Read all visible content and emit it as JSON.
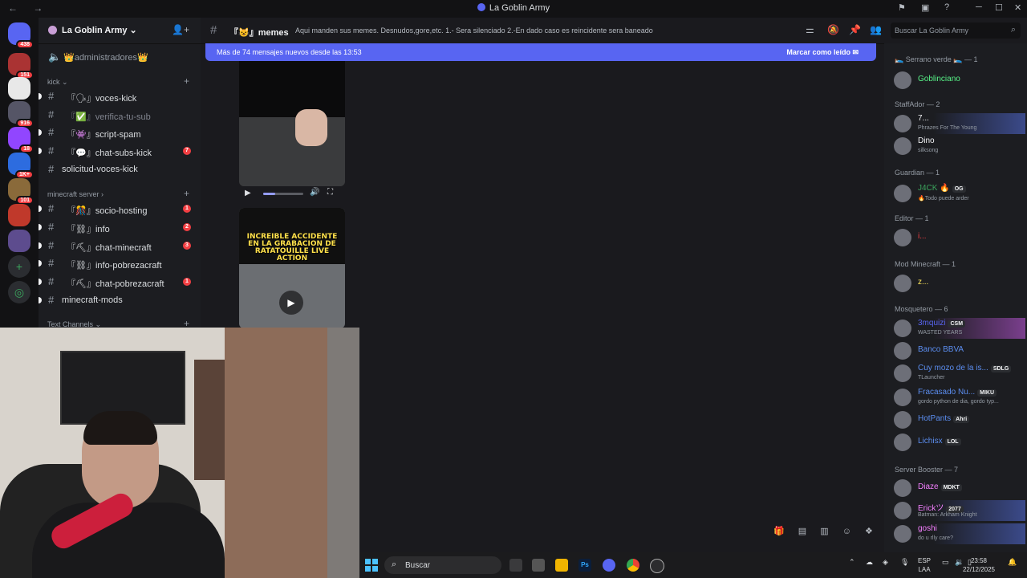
{
  "window": {
    "title": "La Goblin Army"
  },
  "servers": [
    {
      "badge": "438"
    },
    {
      "badge": "151"
    },
    {
      "badge": ""
    },
    {
      "badge": "916"
    },
    {
      "badge": "18"
    },
    {
      "badge": "1K+"
    },
    {
      "badge": "101"
    },
    {
      "badge": ""
    },
    {
      "badge": ""
    }
  ],
  "guild": {
    "name": "La Goblin Army"
  },
  "channels": {
    "top_item": "👑administradores👑",
    "categories": [
      {
        "name": "kick"
      },
      {
        "name": "minecraft server"
      },
      {
        "name": "Text Channels"
      }
    ],
    "items": [
      {
        "label": "『🗣』voces-kick",
        "count": ""
      },
      {
        "label": "『✅』verifica-tu-sub",
        "count": ""
      },
      {
        "label": "『👾』script-spam",
        "count": ""
      },
      {
        "label": "『💬』chat-subs-kick",
        "count": "7"
      },
      {
        "label": "solicitud-voces-kick",
        "count": ""
      },
      {
        "label": "『🎊』socio-hosting",
        "count": "1"
      },
      {
        "label": "『⛓』info",
        "count": "2"
      },
      {
        "label": "『⛏』chat-minecraft",
        "count": "3"
      },
      {
        "label": "『⛓』info-pobrezacraft",
        "count": ""
      },
      {
        "label": "『⛏』chat-pobrezacraft",
        "count": "1"
      },
      {
        "label": "minecraft-mods",
        "count": ""
      }
    ]
  },
  "channel_header": {
    "name": "『😺』memes",
    "topic": "Aqui manden sus memes. Desnudos,gore,etc. 1.- Sera silenciado 2.-En dado caso es reincidente sera baneado"
  },
  "search": {
    "placeholder": "Buscar La Goblin Army"
  },
  "banner": {
    "text": "Más de 74 mensajes nuevos desde las 13:53",
    "action": "Marcar como leído"
  },
  "video": {
    "progress": 0.3,
    "caption": "INCREIBLE ACCIDENTE EN LA GRABACION DE RATATOUILLE LIVE ACTION"
  },
  "members": {
    "groups": [
      {
        "title": "🛌 Serrano verde 🛌 — 1",
        "members": [
          {
            "name": "Goblinciano",
            "status": "",
            "tag": "",
            "color": "#57f287"
          }
        ]
      },
      {
        "title": "StaffAdor — 2",
        "members": [
          {
            "name": "7...",
            "status": "Phrazes For The Young",
            "tag": "",
            "color": "#f2f3f5"
          },
          {
            "name": "Dino",
            "status": "silksong",
            "tag": "",
            "color": "#f2f3f5"
          }
        ]
      },
      {
        "title": "Guardian — 1",
        "members": [
          {
            "name": "J4CK 🔥",
            "status": "🔥Todo puede arder",
            "tag": "OG",
            "color": "#3ba55d"
          }
        ]
      },
      {
        "title": "Editor — 1",
        "members": [
          {
            "name": "i...",
            "status": "",
            "tag": "",
            "color": "#f23f43"
          }
        ]
      },
      {
        "title": "Mod Minecraft — 1",
        "members": [
          {
            "name": "z...",
            "status": "",
            "tag": "",
            "color": "#fee75c"
          }
        ]
      },
      {
        "title": "Mosquetero — 6",
        "members": [
          {
            "name": "3mquizi",
            "status": "WASTED YEARS",
            "tag": "CSM",
            "color": "#5865f2"
          },
          {
            "name": "Banco BBVA",
            "status": "",
            "tag": "",
            "color": "#5b8def"
          },
          {
            "name": "Cuy mozo de la is...",
            "status": "TLauncher",
            "tag": "SDLG",
            "color": "#5b8def"
          },
          {
            "name": "Fracasado Nu...",
            "status": "gordo python de dia, gordo typ...",
            "tag": "MIKU",
            "color": "#5b8def"
          },
          {
            "name": "HotPants",
            "status": "",
            "tag": "Ahri",
            "color": "#5b8def"
          },
          {
            "name": "Lichisx",
            "status": "",
            "tag": "LOL",
            "color": "#5b8def"
          }
        ]
      },
      {
        "title": "Server Booster — 7",
        "members": [
          {
            "name": "Diaze",
            "status": "",
            "tag": "MDKT",
            "color": "#f47fff"
          },
          {
            "name": "Erickツ",
            "status": "Batman: Arkham Knight",
            "tag": "2077",
            "color": "#f47fff"
          },
          {
            "name": "goshi",
            "status": "do u rlly care?",
            "tag": "",
            "color": "#f47fff"
          }
        ]
      }
    ]
  },
  "taskbar": {
    "search": "Buscar",
    "lang_top": "ESP",
    "lang_bottom": "LAA",
    "time": "23:58",
    "date": "22/12/2025"
  }
}
